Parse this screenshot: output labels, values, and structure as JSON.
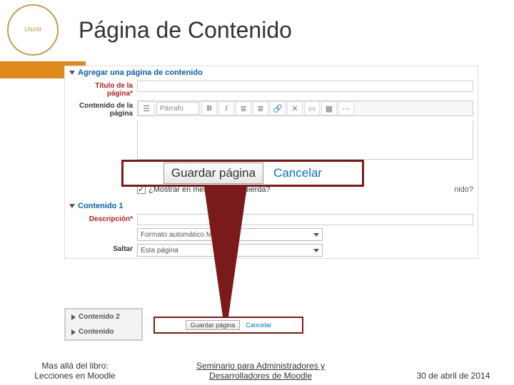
{
  "header": {
    "title": "Página de Contenido",
    "logo_label": "UNAM"
  },
  "form": {
    "section_add": "Agregar una página de contenido",
    "title_label": "Título de la página*",
    "content_label": "Contenido de la página",
    "paragraph_sel": "Párrafo",
    "show_menu_q": "¿Mostrar en menú de la izquierda?",
    "show_menu_suffix": "nido?",
    "section_content1": "Contenido 1",
    "desc_label": "Descripción*",
    "format_sel": "Formato automático Moodle",
    "jump_label": "Saltar",
    "jump_sel": "Esta página",
    "content2": "Contenido 2",
    "content": "Contenido"
  },
  "callout": {
    "save": "Guardar página",
    "cancel": "Cancelar"
  },
  "small_buttons": {
    "save": "Guardar página",
    "cancel": "Cancelar"
  },
  "toolbar_icons": {
    "bold": "B",
    "italic": "I",
    "ul": "≣",
    "ol": "≣"
  },
  "footer": {
    "left1": "Mas allá del libro:",
    "left2": "Lecciones en Moodle",
    "center1": "Seminario para Administradores y",
    "center2": "Desarrolladores de Moodle",
    "right": "30 de abril de 2014"
  }
}
